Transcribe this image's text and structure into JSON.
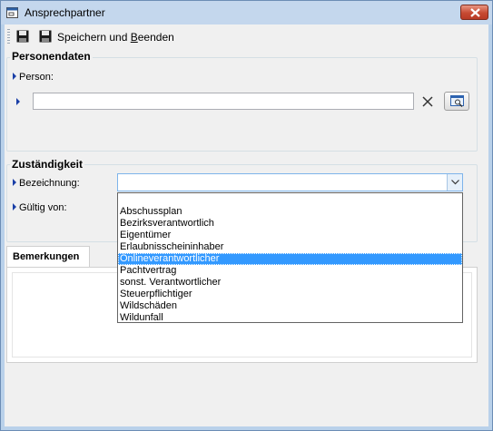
{
  "window": {
    "title": "Ansprechpartner"
  },
  "toolbar": {
    "save_close_pre": "Speichern und ",
    "save_close_underlined": "B",
    "save_close_post": "eenden"
  },
  "personendaten": {
    "title": "Personendaten",
    "person_label": "Person:",
    "person_value": ""
  },
  "zustaendigkeit": {
    "title": "Zuständigkeit",
    "bezeichnung_label": "Bezeichnung:",
    "bezeichnung_value": "",
    "gueltig_label": "Gültig von:",
    "options": [
      "",
      "Abschussplan",
      "Bezirksverantwortlich",
      "Eigentümer",
      "Erlaubnisscheininhaber",
      "Onlineverantwortlicher",
      "Pachtvertrag",
      "sonst. Verantwortlicher",
      "Steuerpflichtiger",
      "Wildschäden",
      "Wildunfall"
    ],
    "highlighted_option": "Onlineverantwortlicher"
  },
  "bemerkungen": {
    "tab_label": "Bemerkungen",
    "text": ""
  },
  "colors": {
    "highlight": "#3399ff",
    "triangle": "#1a3fa7",
    "close_button": "#c74a33"
  },
  "icons": {
    "app": "window-app-icon",
    "save": "floppy-disk-icon",
    "save_close": "floppy-disk-icon",
    "clear": "x-clear-icon",
    "lookup": "search-window-icon",
    "dropdown": "chevron-down-icon"
  }
}
